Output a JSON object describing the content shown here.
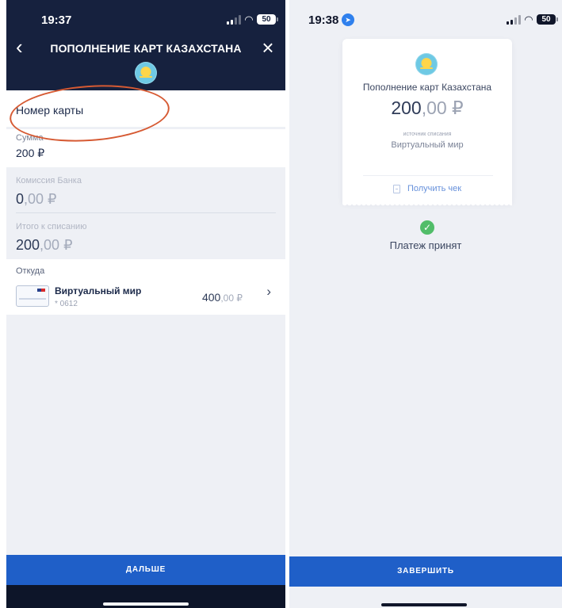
{
  "left_screen": {
    "status": {
      "time": "19:37",
      "battery": "50"
    },
    "title": "ПОПОЛНЕНИЕ КАРТ КАЗАХСТАНА",
    "back_icon": "chevron-left-icon",
    "close_icon": "close-icon",
    "card_number_placeholder": "Номер карты",
    "amount": {
      "label": "Сумма",
      "value": "200 ₽"
    },
    "fee": {
      "label": "Комиссия Банка",
      "value_main": "0",
      "value_decimal": ",00 ₽"
    },
    "total": {
      "label": "Итого к списанию",
      "value_main": "200",
      "value_decimal": ",00 ₽"
    },
    "source": {
      "label": "Откуда",
      "name": "Виртуальный мир",
      "masked_number": "* 0612",
      "balance_main": "400",
      "balance_decimal": ",00 ₽"
    },
    "next_button": "ДАЛЬШЕ"
  },
  "right_screen": {
    "status": {
      "time": "19:38",
      "battery": "50"
    },
    "receipt": {
      "title": "Пополнение карт Казахстана",
      "amount_main": "200",
      "amount_decimal": ",00 ₽",
      "source_caption": "источник списания",
      "source_name": "Виртуальный мир",
      "receipt_link": "Получить чек"
    },
    "status_text": "Платеж принят",
    "finish_button": "ЗАВЕРШИТЬ"
  },
  "colors": {
    "header_navy": "#16213e",
    "primary_blue": "#1f5fc8",
    "success_green": "#51bd69",
    "annotation_orange": "#d65a33"
  }
}
